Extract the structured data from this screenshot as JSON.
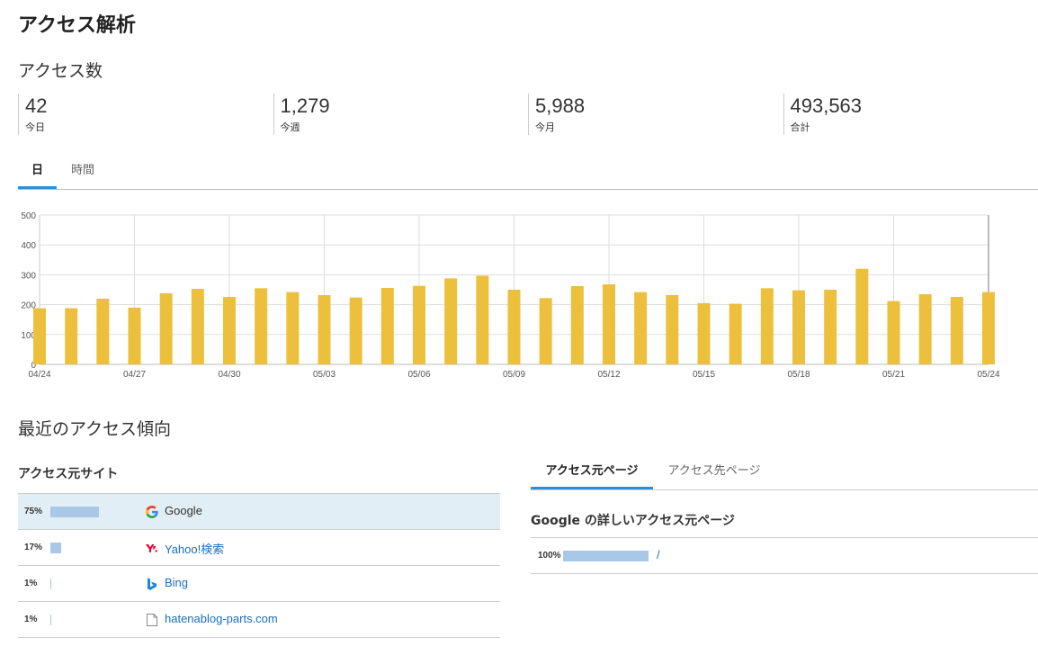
{
  "page_title": "アクセス解析",
  "access_section": {
    "title": "アクセス数",
    "stats": [
      {
        "value": "42",
        "label": "今日"
      },
      {
        "value": "1,279",
        "label": "今週"
      },
      {
        "value": "5,988",
        "label": "今月"
      },
      {
        "value": "493,563",
        "label": "合計"
      }
    ],
    "tabs": [
      "日",
      "時間"
    ],
    "active_tab": "日"
  },
  "chart_data": {
    "type": "bar",
    "categories": [
      "04/24",
      "04/25",
      "04/26",
      "04/27",
      "04/28",
      "04/29",
      "04/30",
      "05/01",
      "05/02",
      "05/03",
      "05/04",
      "05/05",
      "05/06",
      "05/07",
      "05/08",
      "05/09",
      "05/10",
      "05/11",
      "05/12",
      "05/13",
      "05/14",
      "05/15",
      "05/16",
      "05/17",
      "05/18",
      "05/19",
      "05/20",
      "05/21",
      "05/22",
      "05/23",
      "05/24"
    ],
    "values": [
      188,
      188,
      220,
      190,
      238,
      253,
      226,
      255,
      242,
      232,
      224,
      256,
      263,
      288,
      297,
      250,
      222,
      262,
      268,
      242,
      232,
      205,
      203,
      255,
      248,
      250,
      320,
      212,
      235,
      226,
      242
    ],
    "x_tick_labels": [
      "04/24",
      "04/27",
      "04/30",
      "05/03",
      "05/06",
      "05/09",
      "05/12",
      "05/15",
      "05/18",
      "05/21",
      "05/24"
    ],
    "y_tick_labels": [
      "0",
      "100",
      "200",
      "300",
      "400",
      "500"
    ],
    "ylim": [
      0,
      500
    ],
    "grid": true,
    "bar_color": "#ecc03c"
  },
  "trend_section": {
    "title": "最近のアクセス傾向",
    "sites_title": "アクセス元サイト",
    "sites": [
      {
        "percent": "75%",
        "fraction": 0.75,
        "name": "Google",
        "icon": "google-icon",
        "selected": true
      },
      {
        "percent": "17%",
        "fraction": 0.17,
        "name": "Yahoo!検索",
        "icon": "yahoo-icon",
        "selected": false
      },
      {
        "percent": "1%",
        "fraction": 0.01,
        "name": "Bing",
        "icon": "bing-icon",
        "selected": false
      },
      {
        "percent": "1%",
        "fraction": 0.01,
        "name": "hatenablog-parts.com",
        "icon": "document-icon",
        "selected": false
      }
    ],
    "page_tabs": [
      "アクセス元ページ",
      "アクセス先ページ"
    ],
    "active_page_tab": "アクセス元ページ",
    "detail_title": "Google の詳しいアクセス元ページ",
    "pages": [
      {
        "percent": "100%",
        "fraction": 1.0,
        "path": "/"
      }
    ]
  },
  "colors": {
    "accent": "#2f8fd6",
    "bar_fill": "#a9c8e8",
    "selected_row": "#e2eef5",
    "link": "#1a6fbf"
  }
}
